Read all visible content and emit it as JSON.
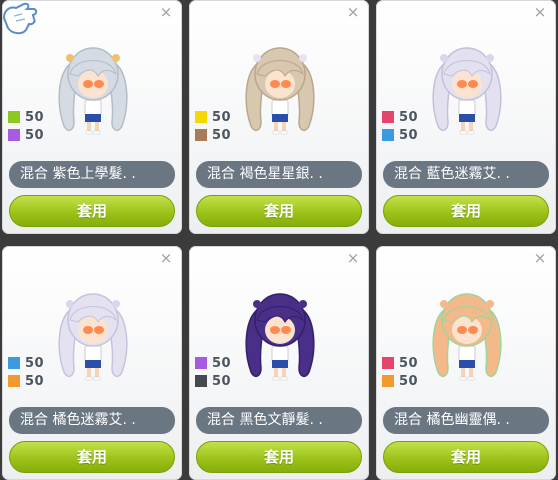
{
  "cards": [
    {
      "stats": [
        {
          "color": "#8cc820",
          "value": "50"
        },
        {
          "color": "#a65be0",
          "value": "50"
        }
      ],
      "name": "混合  紫色上學髮. .",
      "button": "套用",
      "hair": "#d5dbe2",
      "hair_shade": "#b4bcc6",
      "bow": "#f0c070"
    },
    {
      "stats": [
        {
          "color": "#f5d800",
          "value": "50"
        },
        {
          "color": "#a87a5a",
          "value": "50"
        }
      ],
      "name": "混合  褐色星星銀. .",
      "button": "套用",
      "hair": "#d9c8b0",
      "hair_shade": "#b9a68e",
      "bow": "#e9e0f5"
    },
    {
      "stats": [
        {
          "color": "#e6456b",
          "value": "50"
        },
        {
          "color": "#3b9ae0",
          "value": "50"
        }
      ],
      "name": "混合  藍色迷霧艾. .",
      "button": "套用",
      "hair": "#e3e1f0",
      "hair_shade": "#c3c0da",
      "bow": "#d9d6ee"
    },
    {
      "stats": [
        {
          "color": "#3b9ae0",
          "value": "50"
        },
        {
          "color": "#f39a2e",
          "value": "50"
        }
      ],
      "name": "混合  橘色迷霧艾. .",
      "button": "套用",
      "hair": "#e4e2f0",
      "hair_shade": "#c6c3dc",
      "bow": "#d9d6ee"
    },
    {
      "stats": [
        {
          "color": "#a65be0",
          "value": "50"
        },
        {
          "color": "#454a4f",
          "value": "50"
        }
      ],
      "name": "混合  黑色文靜髮. .",
      "button": "套用",
      "hair": "#4a2f88",
      "hair_shade": "#33206a",
      "bow": "#4a2f88"
    },
    {
      "stats": [
        {
          "color": "#e6456b",
          "value": "50"
        },
        {
          "color": "#f39a2e",
          "value": "50"
        }
      ],
      "name": "混合  橘色幽靈偶. .",
      "button": "套用",
      "hair": "#f3b98a",
      "hair_shade": "#9fd49a",
      "bow": "#f3b98a"
    }
  ],
  "close_glyph": "×"
}
